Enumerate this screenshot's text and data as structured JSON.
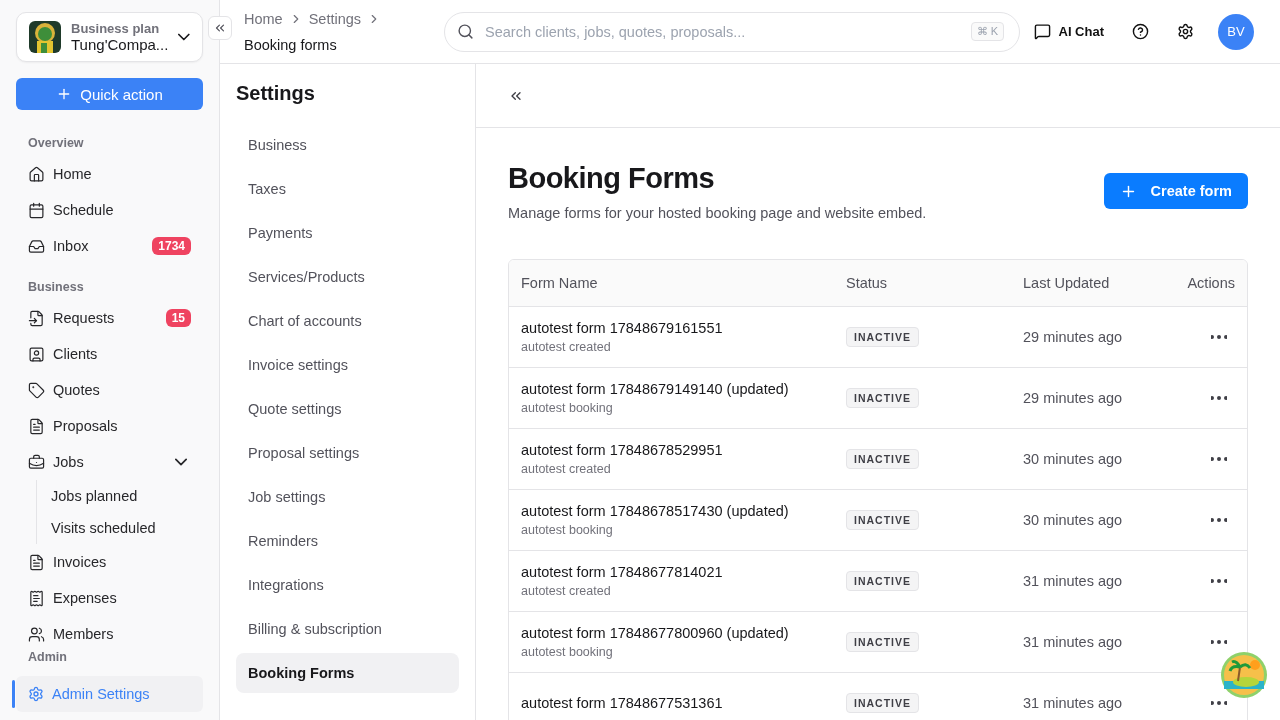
{
  "workspace": {
    "plan": "Business plan",
    "name": "Tung'Compa..."
  },
  "quick_action": {
    "label": "Quick action"
  },
  "sidebar": {
    "sections": [
      {
        "title": "Overview",
        "items": [
          {
            "label": "Home",
            "selected": false
          },
          {
            "label": "Schedule",
            "selected": false
          },
          {
            "label": "Inbox",
            "badge": "1734",
            "selected": false
          }
        ]
      },
      {
        "title": "Business",
        "items": [
          {
            "label": "Requests",
            "badge": "15",
            "selected": false
          },
          {
            "label": "Clients",
            "selected": false
          },
          {
            "label": "Quotes",
            "selected": false
          },
          {
            "label": "Proposals",
            "selected": false
          },
          {
            "label": "Jobs",
            "selected": false,
            "expanded": true,
            "children": [
              {
                "label": "Jobs planned",
                "selected": false
              },
              {
                "label": "Visits scheduled",
                "selected": false
              }
            ]
          },
          {
            "label": "Invoices",
            "selected": false
          },
          {
            "label": "Expenses",
            "selected": false
          },
          {
            "label": "Members",
            "selected": false
          }
        ]
      }
    ],
    "admin": {
      "title": "Admin",
      "items": [
        {
          "label": "Admin Settings",
          "selected": true
        }
      ]
    }
  },
  "breadcrumb": [
    "Home",
    "Settings",
    "Booking forms"
  ],
  "search": {
    "placeholder": "Search clients, jobs, quotes, proposals...",
    "shortcut": "⌘ K"
  },
  "header_actions": {
    "ai_chat": "AI Chat",
    "avatar": "BV"
  },
  "settings_nav": {
    "title": "Settings",
    "items": [
      {
        "label": "Business",
        "selected": false
      },
      {
        "label": "Taxes",
        "selected": false
      },
      {
        "label": "Payments",
        "selected": false
      },
      {
        "label": "Services/Products",
        "selected": false
      },
      {
        "label": "Chart of accounts",
        "selected": false
      },
      {
        "label": "Invoice settings",
        "selected": false
      },
      {
        "label": "Quote settings",
        "selected": false
      },
      {
        "label": "Proposal settings",
        "selected": false
      },
      {
        "label": "Job settings",
        "selected": false
      },
      {
        "label": "Reminders",
        "selected": false
      },
      {
        "label": "Integrations",
        "selected": false
      },
      {
        "label": "Billing & subscription",
        "selected": false
      },
      {
        "label": "Booking Forms",
        "selected": true
      }
    ]
  },
  "page": {
    "title": "Booking Forms",
    "subtitle": "Manage forms for your hosted booking page and website embed.",
    "create_button": "Create form"
  },
  "table": {
    "columns": [
      "Form Name",
      "Status",
      "Last Updated",
      "Actions"
    ],
    "rows": [
      {
        "name": "autotest form 17848679161551",
        "description": "autotest created",
        "status": "INACTIVE",
        "updated": "29 minutes ago"
      },
      {
        "name": "autotest form 17848679149140 (updated)",
        "description": "autotest booking",
        "status": "INACTIVE",
        "updated": "29 minutes ago"
      },
      {
        "name": "autotest form 17848678529951",
        "description": "autotest created",
        "status": "INACTIVE",
        "updated": "30 minutes ago"
      },
      {
        "name": "autotest form 17848678517430 (updated)",
        "description": "autotest booking",
        "status": "INACTIVE",
        "updated": "30 minutes ago"
      },
      {
        "name": "autotest form 17848677814021",
        "description": "autotest created",
        "status": "INACTIVE",
        "updated": "31 minutes ago"
      },
      {
        "name": "autotest form 17848677800960 (updated)",
        "description": "autotest booking",
        "status": "INACTIVE",
        "updated": "31 minutes ago"
      },
      {
        "name": "autotest form 17848677531361",
        "status": "INACTIVE",
        "updated": "31 minutes ago"
      }
    ]
  }
}
